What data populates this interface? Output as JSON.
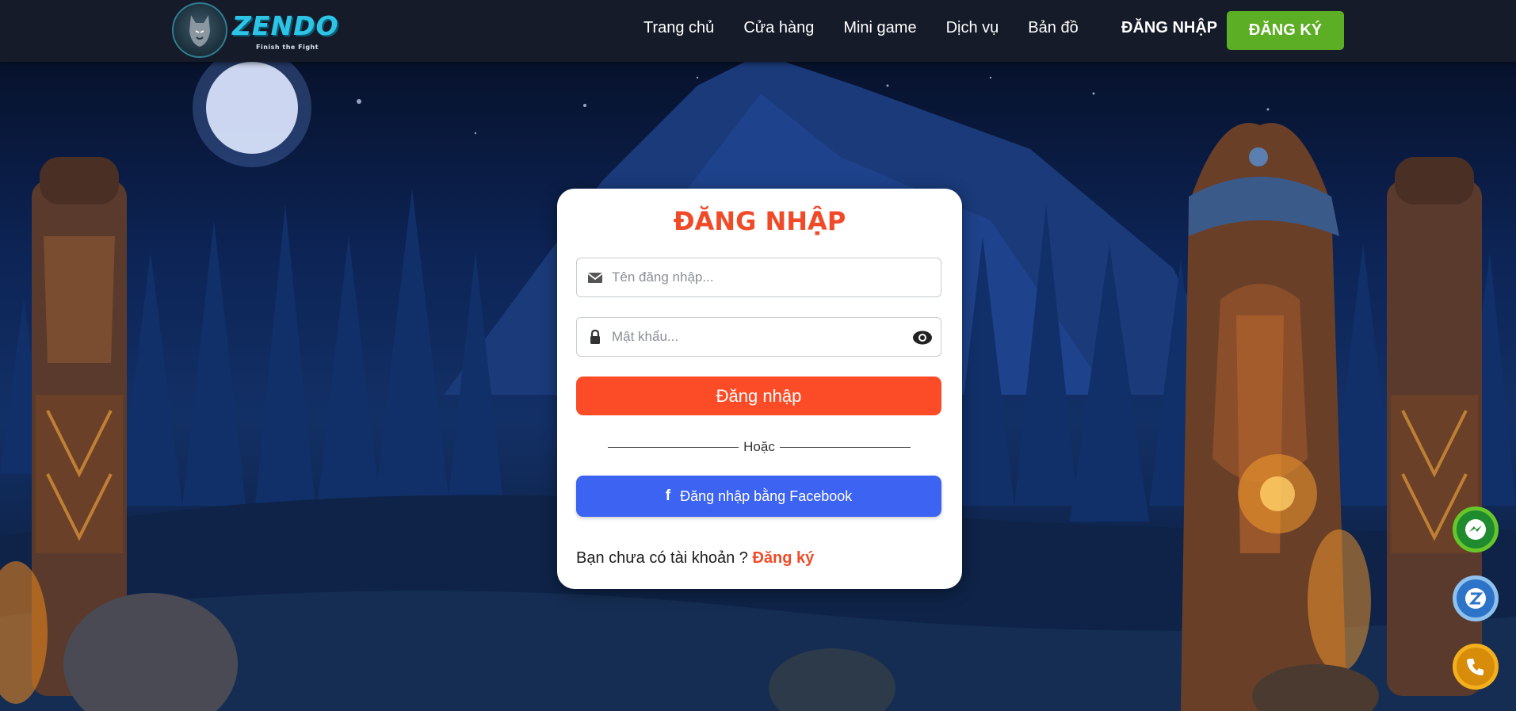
{
  "brand": {
    "name": "ZENDO",
    "tagline": "Finish the Fight"
  },
  "nav": {
    "items": [
      "Trang chủ",
      "Cửa hàng",
      "Mini game",
      "Dịch vụ",
      "Bản đồ"
    ],
    "login_label": "ĐĂNG NHẬP",
    "register_label": "ĐĂNG KÝ"
  },
  "login_form": {
    "title": "ĐĂNG NHẬP",
    "username": {
      "value": "",
      "placeholder": "Tên đăng nhập...",
      "icon": "envelope-icon"
    },
    "password": {
      "value": "",
      "placeholder": "Mật khẩu...",
      "icon": "lock-icon",
      "toggle_icon": "eye-icon"
    },
    "submit_label": "Đăng nhập",
    "divider_text": "Hoặc",
    "facebook_label": "Đăng nhập bằng Facebook",
    "facebook_icon": "f",
    "signup_prompt": "Bạn chưa có tài khoản ?",
    "signup_link": "Đăng ký"
  },
  "floating_buttons": [
    {
      "name": "messenger-icon",
      "color": "#67c62a"
    },
    {
      "name": "zalo-icon",
      "color": "#2d74c9"
    },
    {
      "name": "phone-icon",
      "color": "#f3b01c"
    }
  ],
  "colors": {
    "accent": "#f04b29",
    "button": "#fb4c27",
    "facebook": "#3d63f2",
    "register": "#5cae24",
    "header": "#161b29"
  }
}
